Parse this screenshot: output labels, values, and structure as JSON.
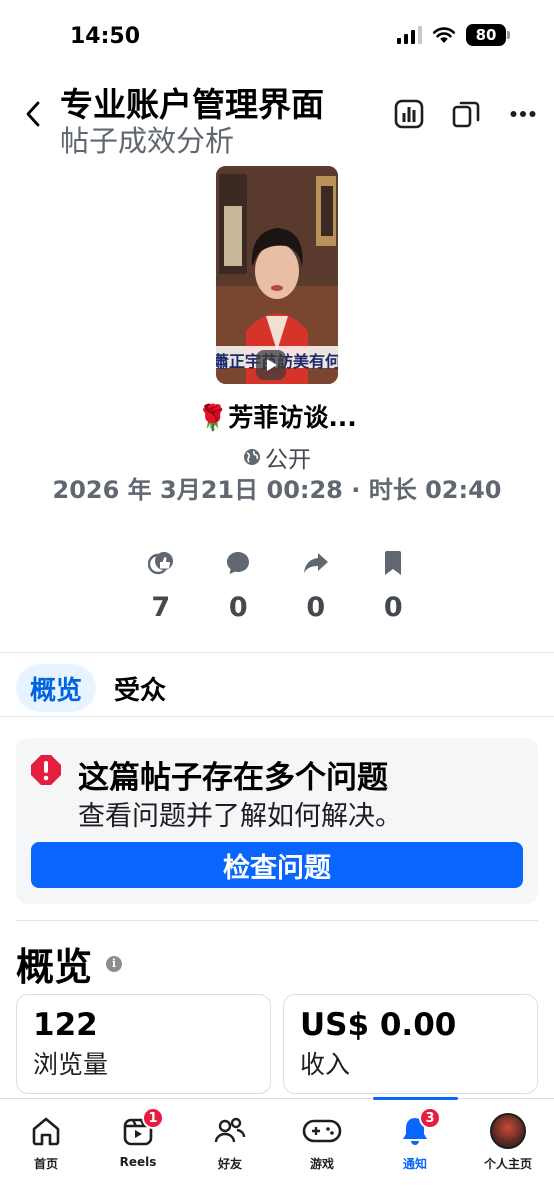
{
  "status_bar": {
    "time": "14:50",
    "battery": "80"
  },
  "header": {
    "title": "专业账户管理界面",
    "subtitle": "帖子成效分析"
  },
  "post": {
    "thumbnail_caption": "蕭正宇苗訪美有何",
    "title_emoji": "🌹",
    "title": "芳菲访谈...",
    "privacy": "公开",
    "meta": "2026 年 3月21日 00:28 · 时长 02:40"
  },
  "stats": [
    {
      "icon": "like-icon",
      "value": "7"
    },
    {
      "icon": "comment-icon",
      "value": "0"
    },
    {
      "icon": "share-icon",
      "value": "0"
    },
    {
      "icon": "bookmark-icon",
      "value": "0"
    }
  ],
  "tabs": [
    {
      "label": "概览",
      "active": true
    },
    {
      "label": "受众",
      "active": false
    }
  ],
  "issue": {
    "title": "这篇帖子存在多个问题",
    "description": "查看问题并了解如何解决。",
    "button": "检查问题"
  },
  "overview": {
    "title": "概览",
    "metrics": [
      {
        "value": "122",
        "label": "浏览量"
      },
      {
        "value": "US$ 0.00",
        "label": "收入"
      }
    ]
  },
  "bottom_nav": [
    {
      "label": "首页",
      "icon": "home-icon"
    },
    {
      "label": "Reels",
      "icon": "reels-icon",
      "badge": "1"
    },
    {
      "label": "好友",
      "icon": "friends-icon"
    },
    {
      "label": "游戏",
      "icon": "gaming-icon"
    },
    {
      "label": "通知",
      "icon": "bell-icon",
      "badge": "3",
      "active": true
    },
    {
      "label": "个人主页",
      "icon": "profile-avatar"
    }
  ],
  "colors": {
    "accent": "#0866ff",
    "badge": "#e41e3f",
    "alert": "#e41e3f"
  }
}
